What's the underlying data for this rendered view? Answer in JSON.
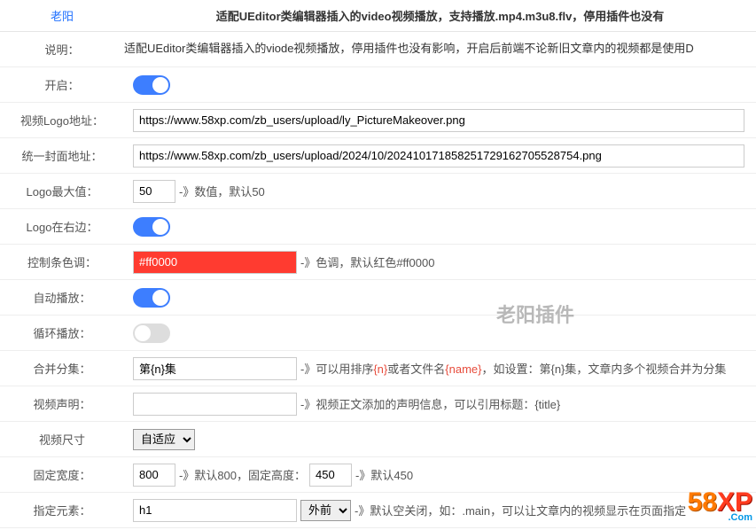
{
  "header": {
    "author": "老阳",
    "title": "适配UEditor类编辑器插入的video视频播放，支持播放.mp4.m3u8.flv，停用插件也没有"
  },
  "rows": {
    "desc": {
      "label": "说明：",
      "text": "适配UEditor类编辑器插入的viode视频播放，停用插件也没有影响，开启后前端不论新旧文章内的视频都是使用D"
    },
    "enable": {
      "label": "开启：",
      "value": true
    },
    "logoUrl": {
      "label": "视频Logo地址：",
      "value": "https://www.58xp.com/zb_users/upload/ly_PictureMakeover.png"
    },
    "coverUrl": {
      "label": "统一封面地址：",
      "value": "https://www.58xp.com/zb_users/upload/2024/10/202410171858251729162705528754.png"
    },
    "logoMax": {
      "label": "Logo最大值：",
      "value": "50",
      "hint": "-》数值，默认50"
    },
    "logoRight": {
      "label": "Logo在右边：",
      "value": true
    },
    "controlColor": {
      "label": "控制条色调：",
      "value": "#ff0000",
      "hint": "-》色调，默认红色#ff0000"
    },
    "autoplay": {
      "label": "自动播放：",
      "value": true
    },
    "loop": {
      "label": "循环播放：",
      "value": false
    },
    "mergeEp": {
      "label": "合并分集：",
      "value": "第{n}集",
      "hint_pre": "-》可以用排序",
      "hint_n": "{n}",
      "hint_mid": "或者文件名",
      "hint_name": "{name}",
      "hint_post": "，如设置：第{n}集，文章内多个视频合并为分集"
    },
    "statement": {
      "label": "视频声明：",
      "value": "",
      "hint": "-》视频正文添加的声明信息，可以引用标题：{title}"
    },
    "size": {
      "label": "视频尺寸",
      "value": "自适应",
      "options": [
        "自适应"
      ]
    },
    "fixedW": {
      "label": "固定宽度：",
      "value": "800",
      "hint1": "-》默认800，固定高度：",
      "value2": "450",
      "hint2": "-》默认450"
    },
    "target": {
      "label": "指定元素：",
      "value": "h1",
      "pos": "外前",
      "posOptions": [
        "外前"
      ],
      "hint": "-》默认空关闭，如：.main，可以让文章内的视频显示在页面指定"
    }
  },
  "watermark": "老阳插件",
  "logo": {
    "p1": "58",
    "p2": "XP",
    "sub": ".Com"
  }
}
